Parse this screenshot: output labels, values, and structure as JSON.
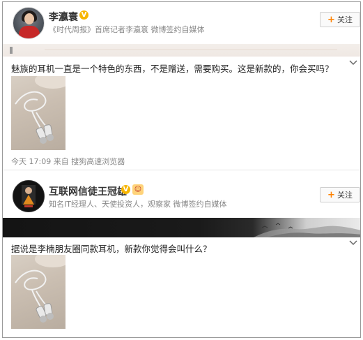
{
  "posts": [
    {
      "user_name": "李瀛寰",
      "verified_mark": "V",
      "subtitle": "《时代周报》首席记者李瀛寰 微博签约自媒体",
      "follow_label": "关注",
      "text": "魅族的耳机一直是一个特色的东西，不是赠送，需要购买。这是新款的，你会买吗？",
      "meta": "今天 17:09 来自 搜狗高速浏览器"
    },
    {
      "user_name": "互联网信徒王冠雄",
      "verified_mark": "V",
      "subtitle": "知名IT经理人、天使投资人，观察家 微博签约自媒体",
      "follow_label": "关注",
      "text": "据说是李楠朋友圈同款耳机，新款你觉得会叫什么？"
    }
  ],
  "colors": {
    "accent": "#ff8200",
    "verified": "#f7b500",
    "muted_text": "#888888"
  }
}
